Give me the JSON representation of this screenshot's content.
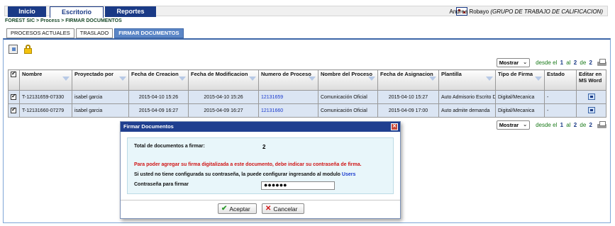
{
  "nav": {
    "tabs": [
      {
        "label": "Inicio"
      },
      {
        "label": "Escritorio"
      },
      {
        "label": "Reportes"
      }
    ],
    "user_name": "Andrea Robayo",
    "user_group": "(GRUPO DE TRABAJO DE CALIFICACION)"
  },
  "breadcrumb": "FOREST SIC > Process > FIRMAR DOCUMENTOS",
  "subtabs": [
    {
      "label": "PROCESOS ACTUALES"
    },
    {
      "label": "TRASLADO"
    },
    {
      "label": "FIRMAR DOCUMENTOS"
    }
  ],
  "pager": {
    "select_label": "Mostrar",
    "range_prefix": "desde el",
    "current": "1",
    "sep": "al",
    "end": "2",
    "of": "de",
    "total": "2"
  },
  "table": {
    "headers": [
      "Nombre",
      "Proyectado por",
      "Fecha de Creacion",
      "Fecha de Modificacion",
      "Numero de Proceso",
      "Nombre del Proceso",
      "Fecha de Asignacion",
      "Plantilla",
      "Tipo de Firma",
      "Estado",
      "Editar en MS Word"
    ],
    "rows": [
      {
        "nombre": "T-12131659-07330",
        "proyectado": "isabel garcia",
        "creacion": "2015-04-10 15:26",
        "modificacion": "2015-04-10 15:26",
        "numero": "12131659",
        "proceso": "Comunicación Oficial",
        "asignacion": "2015-04-10 15:27",
        "plantilla": "Auto Admisorio Escrito Demanda",
        "firma": "Digital/Mecanica",
        "estado": "-"
      },
      {
        "nombre": "T-12131660-07279",
        "proyectado": "isabel garcia",
        "creacion": "2015-04-09 16:27",
        "modificacion": "2015-04-09 16:27",
        "numero": "12131660",
        "proceso": "Comunicación Oficial",
        "asignacion": "2015-04-09 17:00",
        "plantilla": "Auto admite demanda",
        "firma": "Digital/Mecanica",
        "estado": "-"
      }
    ]
  },
  "dialog": {
    "title": "Firmar Documentos",
    "close_glyph": "✕",
    "total_label": "Total de documentos a firmar:",
    "total_value": "2",
    "warning": "Para poder agregar su firma digitalizada a este documento, debe indicar su contraseña de firma.",
    "info_text": "Si usted no tiene configurada su contraseña, la puede configurar ingresando al modulo",
    "info_link": "Users",
    "password_label": "Contraseña para firmar",
    "password_value": "●●●●●●",
    "accept_label": "Aceptar",
    "cancel_label": "Cancelar"
  }
}
